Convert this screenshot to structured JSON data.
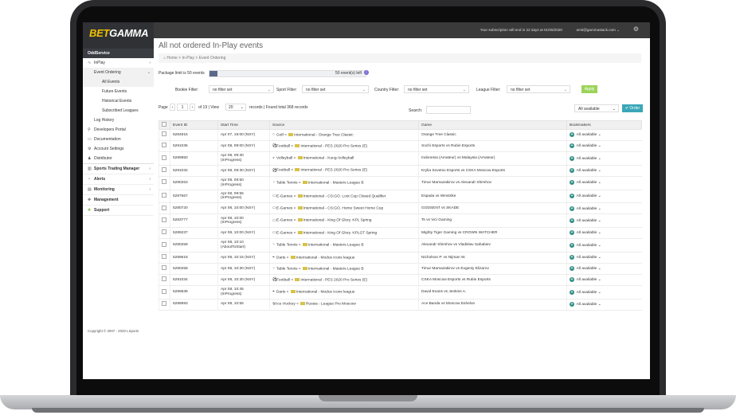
{
  "brand": {
    "part1": "BET",
    "part2": "GAMMA"
  },
  "topbar": {
    "subscription_msg": "Your subscription will end in 22 days at 01/05/2020",
    "user": "amit@gammastack.com ⌄"
  },
  "sidebar": {
    "oddservice": "OddService",
    "inplay": "InPlay",
    "event_ordering": "Event Ordering",
    "all_events": "All Events",
    "future_events": "Future Events",
    "historical_events": "Historical Events",
    "subscribed_leagues": "Subscribed Leagues",
    "log_history": "Log History",
    "developers_portal": "Developers Portal",
    "documentation": "Documentation",
    "account_settings": "Account Settings",
    "distributor": "Distributor",
    "sports_trading_manager": "Sports Trading Manager",
    "alerts": "Alerts",
    "monitoring": "Monitoring",
    "management": "Management",
    "support": "Support",
    "copyright": "Copyright © 2007 - 2020 LSports"
  },
  "page": {
    "title": "All not ordered In-Play events",
    "breadcrumb": [
      "Home",
      "In-Play",
      "Event Ordering"
    ]
  },
  "package": {
    "label": "Package limit is 50 events",
    "left": "50 event(s) left",
    "used_fraction": 0.05
  },
  "filters": {
    "bookie_label": "Bookie Filter:",
    "sport_label": "Sport Filter:",
    "country_label": "Country Filter:",
    "league_label": "League Filter:",
    "placeholder": "no filter set",
    "apply": "Apply"
  },
  "pager": {
    "page_label": "Page",
    "page_num": "1",
    "of_view": "of 19 | View",
    "per_page": "20",
    "records": "records | Found total 368 records",
    "search_label": "Search:",
    "avail_select": "All available",
    "order_button": "✔ Order"
  },
  "table": {
    "headers": [
      "Event ID",
      "Start Time",
      "Source",
      "Game",
      "Bookmakers"
    ],
    "avail": "All available",
    "rows": [
      {
        "id": "5284915",
        "time": "Apr 07, 19:00 (NSY)",
        "time2": "",
        "sport": "Golf",
        "region": "International",
        "league": "Orange Tree Classic",
        "game": "Orange Tree Classic",
        "icon": "○"
      },
      {
        "id": "5291035",
        "time": "Apr 08, 09:00 (NSY)",
        "time2": "",
        "sport": "Football",
        "region": "International",
        "league": "PES 2020 Pro Series (E)",
        "game": "Sochi Esports vs Rubin Esports",
        "icon": "⚽"
      },
      {
        "id": "5289950",
        "time": "Apr 08, 09:30",
        "time2": "(InProgress)",
        "sport": "Volleyball",
        "region": "International",
        "league": "Kung-Volleyball",
        "game": "Indonesia (Amateur) vs Malaysia (Amateur)",
        "icon": "◒"
      },
      {
        "id": "5291032",
        "time": "Apr 08, 09:30 (NSY)",
        "time2": "",
        "sport": "Football",
        "region": "International",
        "league": "PES 2020 Pro Series (E)",
        "game": "Krylia Sovetov Esports vs CSKA Moscow Esports",
        "icon": "⚽"
      },
      {
        "id": "5290263",
        "time": "Apr 08, 09:50",
        "time2": "(InProgress)",
        "sport": "Table Tennis",
        "region": "International",
        "league": "Masters League B",
        "game": "Timur Mamazakirov vs Alexandr Shirshov",
        "icon": "◔"
      },
      {
        "id": "5287567",
        "time": "Apr 08, 09:55",
        "time2": "(InProgress)",
        "sport": "E-Games",
        "region": "International",
        "league": "CS:GO. Loot Cup Closed Qualifier",
        "game": "Espada vs Winstrike",
        "icon": "▭"
      },
      {
        "id": "5280720",
        "time": "Apr 08, 10:00 (NSY)",
        "time2": "",
        "sport": "E-Games",
        "region": "International",
        "league": "CS:GO. Home Sweet Home Cup",
        "game": "GODSENT vs SKADE",
        "icon": "▭"
      },
      {
        "id": "5283777",
        "time": "Apr 08, 10:00",
        "time2": "(InProgress)",
        "sport": "E-Games",
        "region": "International",
        "league": "King Of Glory. KPL Spring",
        "game": "Ts vs Vici Gaming",
        "icon": "▭"
      },
      {
        "id": "5289237",
        "time": "Apr 08, 10:00 (NSY)",
        "time2": "",
        "sport": "E-Games",
        "region": "International",
        "league": "King Of Glory. KPLGT Spring",
        "game": "Mighty Tiger Gaming vs CROWN WATCHER",
        "icon": "▭"
      },
      {
        "id": "5290259",
        "time": "Apr 08, 10:10",
        "time2": "(AboutToStart)",
        "sport": "Table Tennis",
        "region": "International",
        "league": "Masters League B",
        "game": "Alexandr Shirshov vs Vladislav Sahabiev",
        "icon": "◔"
      },
      {
        "id": "5289618",
        "time": "Apr 08, 10:15 (NSY)",
        "time2": "",
        "sport": "Darts",
        "region": "International",
        "league": "Modus Icons league",
        "game": "Nicholson P. vs Nijman W.",
        "icon": "⌖"
      },
      {
        "id": "5290258",
        "time": "Apr 08, 10:30 (NSY)",
        "time2": "",
        "sport": "Table Tennis",
        "region": "International",
        "league": "Masters League B",
        "game": "Timur Mamazakirov vs Evgeniy Elizarov",
        "icon": "◔"
      },
      {
        "id": "5291034",
        "time": "Apr 08, 10:30 (NSY)",
        "time2": "",
        "sport": "Football",
        "region": "International",
        "league": "PES 2020 Pro Series (E)",
        "game": "CSKA Moscow Esports vs Rubin Esports",
        "icon": "⚽"
      },
      {
        "id": "5289639",
        "time": "Apr 08, 10:45",
        "time2": "(InProgress)",
        "sport": "Darts",
        "region": "International",
        "league": "Modus Icons league",
        "game": "David Evans vs Jenkins A.",
        "icon": "⌖"
      },
      {
        "id": "5288993",
        "time": "Apr 08, 10:55",
        "time2": "",
        "sport": "Ice Hockey",
        "region": "Russia",
        "league": "League Pro Moscow",
        "game": "Ace Banda vs Moscow Eshelon",
        "icon": "⚒"
      }
    ]
  }
}
